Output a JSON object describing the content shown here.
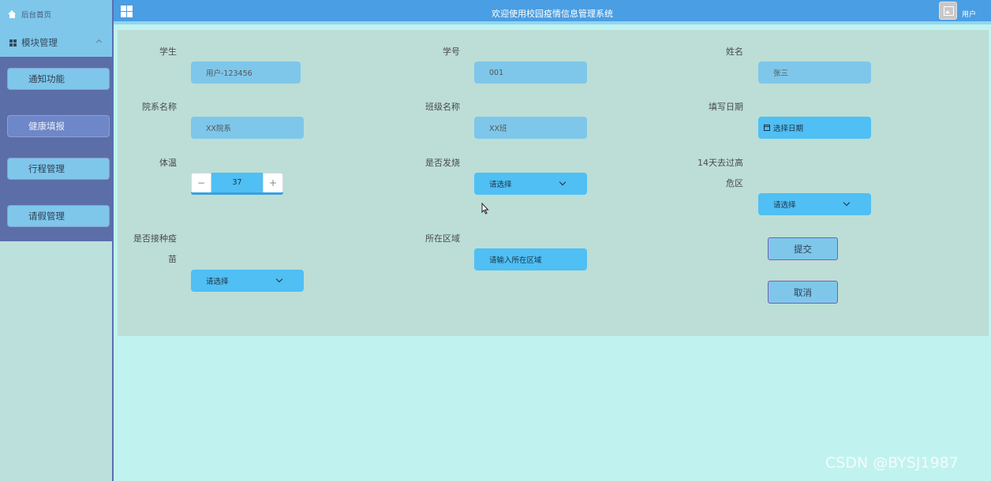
{
  "sidebar": {
    "home_label": "后台首页",
    "module_label": "模块管理",
    "items": [
      {
        "label": "通知功能",
        "active": false
      },
      {
        "label": "健康填报",
        "active": true
      },
      {
        "label": "行程管理",
        "active": false
      },
      {
        "label": "请假管理",
        "active": false
      }
    ]
  },
  "header": {
    "title": "欢迎使用校园疫情信息管理系统",
    "user_label": "用户"
  },
  "form": {
    "student": {
      "label": "学生",
      "value": "用户-123456"
    },
    "student_no": {
      "label": "学号",
      "value": "001"
    },
    "name": {
      "label": "姓名",
      "value": "张三"
    },
    "department": {
      "label": "院系名称",
      "value": "XX院系"
    },
    "class_name": {
      "label": "班级名称",
      "value": "XX班"
    },
    "fill_date": {
      "label": "填写日期",
      "placeholder": "选择日期"
    },
    "temperature": {
      "label": "体温",
      "value": "37",
      "minus": "−",
      "plus": "+"
    },
    "fever": {
      "label": "是否发烧",
      "placeholder": "请选择"
    },
    "high_risk": {
      "label_line1": "14天去过高",
      "label_line2": "危区",
      "placeholder": "请选择"
    },
    "vaccinated": {
      "label_line1": "是否接种疫",
      "label_line2": "苗",
      "placeholder": "请选择"
    },
    "region": {
      "label": "所在区域",
      "placeholder": "请输入所在区域"
    },
    "submit_label": "提交",
    "cancel_label": "取消"
  },
  "watermark": "CSDN @BYSJ1987",
  "colors": {
    "header_bg": "#4a9ee3",
    "sidebar_menu_bg": "#5b6ea8",
    "field_bg": "#7ec7ea",
    "select_bg": "#4fbff4",
    "panel_bg": "#bcded6",
    "page_bg": "#c0f3ef"
  }
}
